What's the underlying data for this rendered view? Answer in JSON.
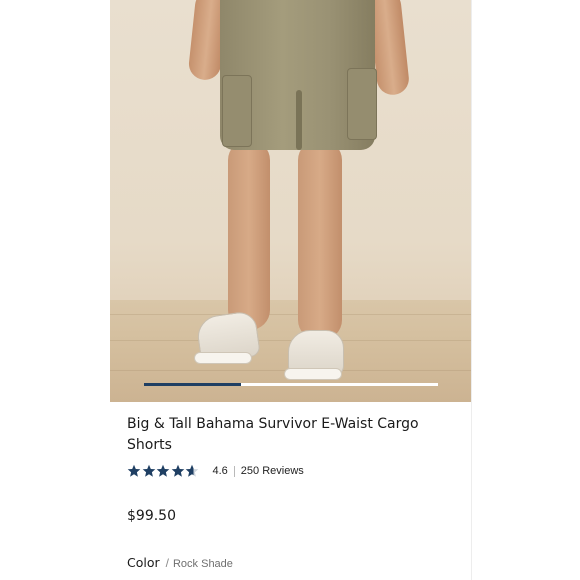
{
  "product": {
    "title": "Big & Tall Bahama Survivor E-Waist Cargo Shorts",
    "rating_value": "4.6",
    "rating_fraction": 0.92,
    "reviews_label": "250 Reviews",
    "price": "$99.50",
    "color_label": "Color",
    "color_separator": "/",
    "color_value": "Rock Shade"
  },
  "gallery": {
    "progress_fraction": 0.33
  },
  "colors": {
    "accent": "#1f3f63",
    "star": "#1f3f63"
  }
}
